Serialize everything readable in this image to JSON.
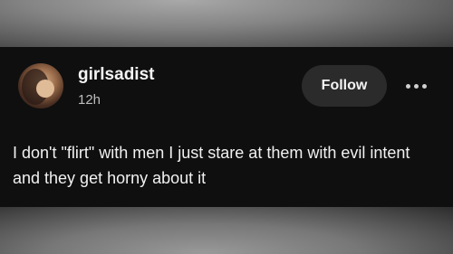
{
  "post": {
    "username": "girlsadist",
    "timestamp": "12h",
    "follow_label": "Follow",
    "more_icon": "more-horizontal-icon",
    "body": "I don't \"flirt\" with men I just stare at them with evil intent and they get horny about it"
  },
  "colors": {
    "card_background": "#0f0f0f",
    "button_background": "#2b2b2b",
    "text_primary": "#f2f2f2",
    "text_secondary": "#bdbdbd"
  }
}
